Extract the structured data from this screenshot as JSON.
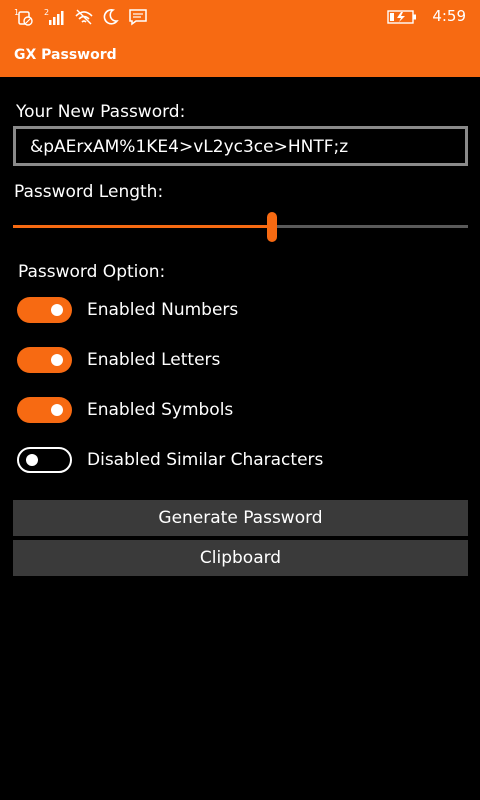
{
  "status_bar": {
    "time": "4:59",
    "icons": [
      "sim1-icon",
      "sim2-signal-icon",
      "wifi-icon",
      "quiet-hours-icon",
      "message-icon",
      "battery-charging-icon"
    ],
    "sim1_label": "1",
    "sim2_label": "2"
  },
  "app": {
    "title": "GX Password"
  },
  "password": {
    "label": "Your New Password:",
    "value": "&pAErxAM%1KE4>vL2yc3ce>HNTF;z"
  },
  "length": {
    "label": "Password Length:",
    "slider_fraction": 0.569
  },
  "options": {
    "label": "Password Option:",
    "items": [
      {
        "label": "Enabled Numbers",
        "on": true
      },
      {
        "label": "Enabled Letters",
        "on": true
      },
      {
        "label": "Enabled Symbols",
        "on": true
      },
      {
        "label": "Disabled Similar Characters",
        "on": false
      }
    ]
  },
  "buttons": {
    "generate": "Generate Password",
    "clipboard": "Clipboard"
  },
  "colors": {
    "accent": "#f76a12",
    "button_bg": "#3a3a3a",
    "background": "#000000"
  }
}
